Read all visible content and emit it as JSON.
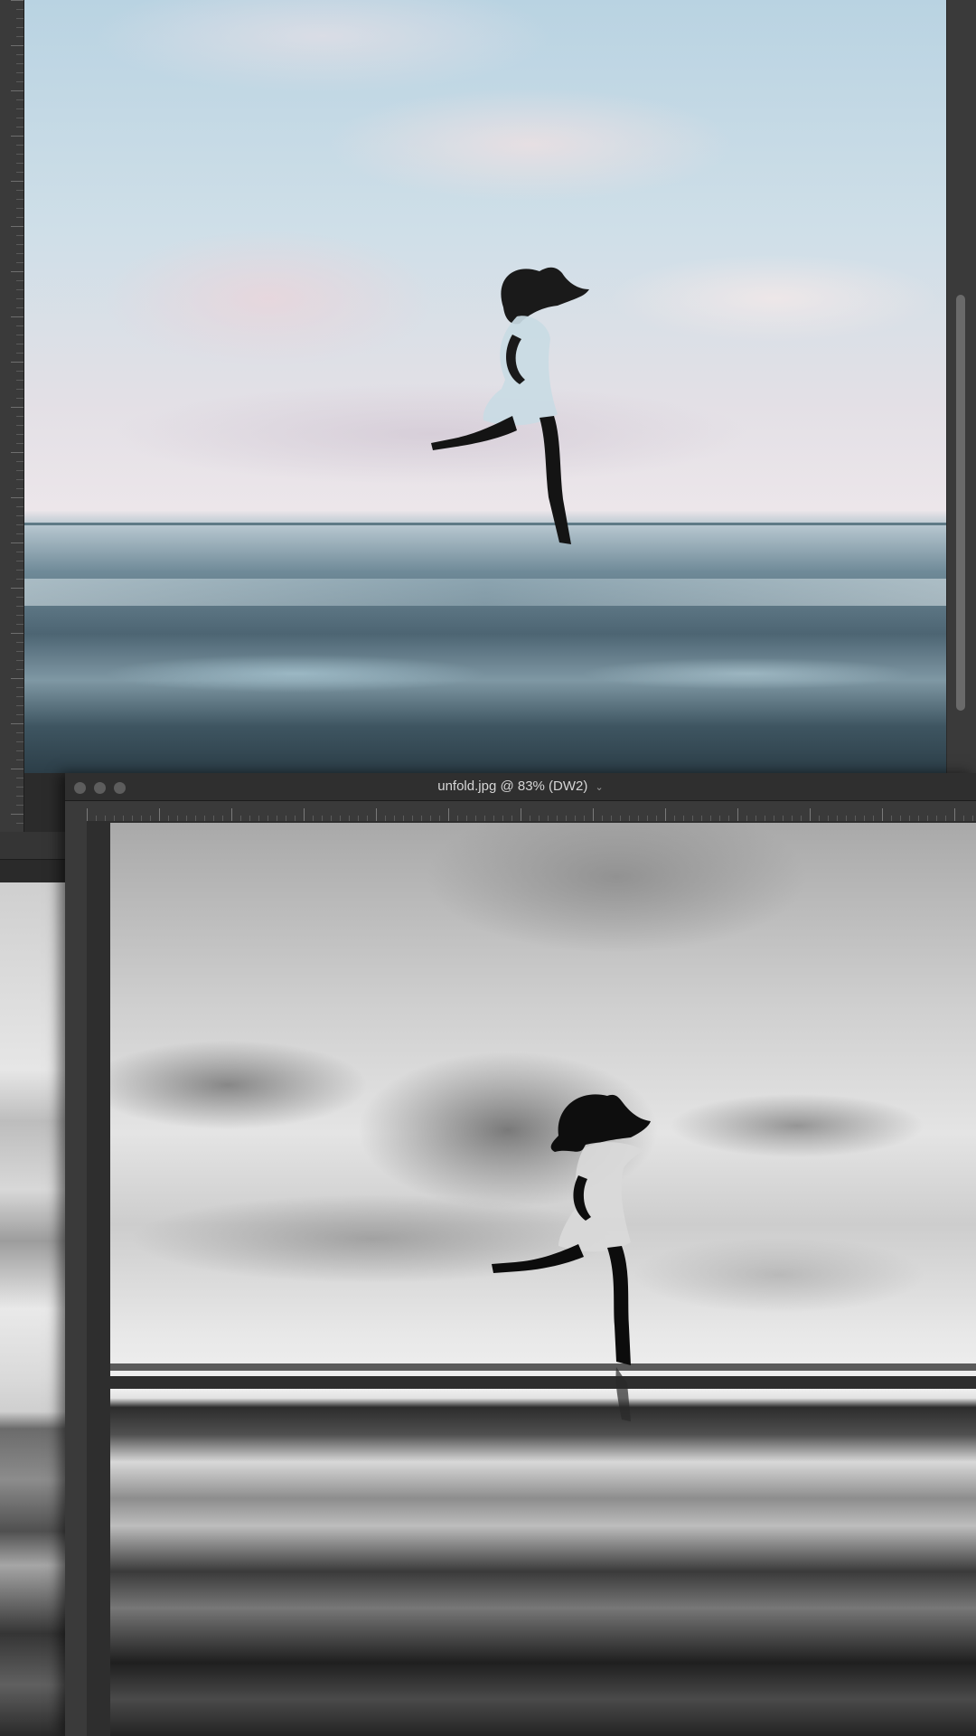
{
  "front_window": {
    "title": "unfold.jpg @ 83% (DW2)",
    "title_chevron": "chevron-down-icon",
    "traffic_lights": [
      "close-button",
      "minimize-button",
      "zoom-button"
    ]
  },
  "back_window": {
    "image_mode": "color"
  },
  "left_window": {
    "image_mode": "grayscale"
  },
  "colors": {
    "chrome_dark": "#2b2b2b",
    "title_text": "#d6d6d6",
    "scroll_thumb": "#6a6a6a"
  }
}
